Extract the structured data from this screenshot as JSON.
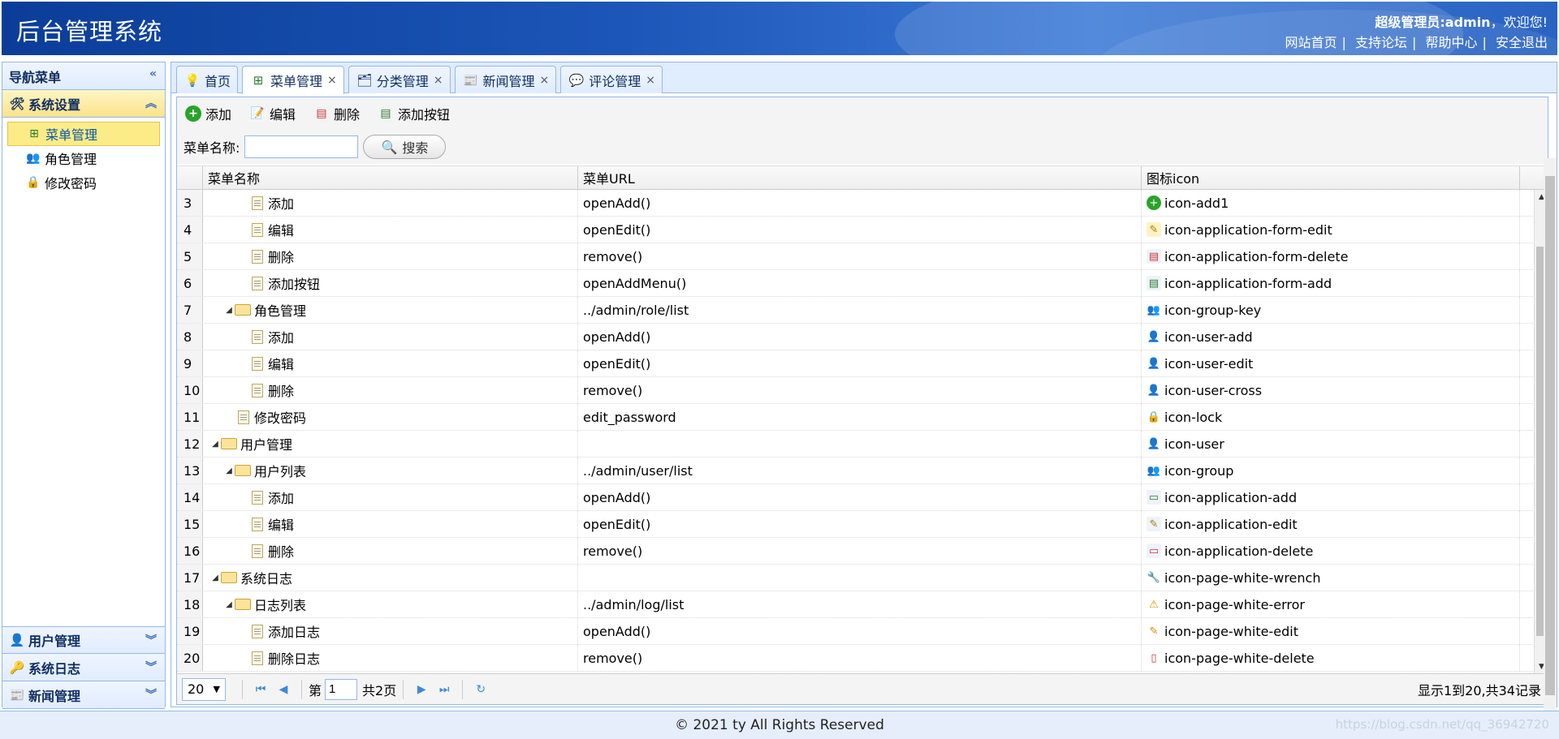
{
  "header": {
    "title": "后台管理系统",
    "welcome_role": "超级管理员:admin",
    "welcome_suffix": "，欢迎您!",
    "links": [
      "网站首页",
      "支持论坛",
      "帮助中心",
      "安全退出"
    ],
    "link_sep": "|"
  },
  "sidebar": {
    "title": "导航菜单",
    "collapse_icon": "«",
    "groups": [
      {
        "label": "系统设置",
        "icon": "wrench-icon"
      },
      {
        "label": "用户管理",
        "icon": "user-icon"
      },
      {
        "label": "系统日志",
        "icon": "key-icon"
      },
      {
        "label": "新闻管理",
        "icon": "news-icon"
      }
    ],
    "items": [
      {
        "label": "菜单管理",
        "icon": "sitemap-icon"
      },
      {
        "label": "角色管理",
        "icon": "group-key-icon"
      },
      {
        "label": "修改密码",
        "icon": "lock-icon"
      }
    ]
  },
  "tabs": [
    {
      "label": "首页",
      "icon": "lightbulb-icon",
      "closable": false
    },
    {
      "label": "菜单管理",
      "icon": "sitemap-icon",
      "closable": true
    },
    {
      "label": "分类管理",
      "icon": "category-icon",
      "closable": true
    },
    {
      "label": "新闻管理",
      "icon": "news-icon",
      "closable": true
    },
    {
      "label": "评论管理",
      "icon": "comment-icon",
      "closable": true
    }
  ],
  "toolbar": {
    "add": "添加",
    "edit": "编辑",
    "delete": "删除",
    "add_button": "添加按钮"
  },
  "search": {
    "label": "菜单名称:",
    "value": "",
    "button": "搜索"
  },
  "grid": {
    "columns": [
      "菜单名称",
      "菜单URL",
      "图标icon"
    ],
    "rows": [
      {
        "num": "3",
        "name": "添加",
        "level": 3,
        "type": "page",
        "url": "openAdd()",
        "icon": "icon-add1"
      },
      {
        "num": "4",
        "name": "编辑",
        "level": 3,
        "type": "page",
        "url": "openEdit()",
        "icon": "icon-application-form-edit"
      },
      {
        "num": "5",
        "name": "删除",
        "level": 3,
        "type": "page",
        "url": "remove()",
        "icon": "icon-application-form-delete"
      },
      {
        "num": "6",
        "name": "添加按钮",
        "level": 3,
        "type": "page",
        "url": "openAddMenu()",
        "icon": "icon-application-form-add"
      },
      {
        "num": "7",
        "name": "角色管理",
        "level": 2,
        "type": "folder",
        "url": "../admin/role/list",
        "icon": "icon-group-key"
      },
      {
        "num": "8",
        "name": "添加",
        "level": 3,
        "type": "page",
        "url": "openAdd()",
        "icon": "icon-user-add"
      },
      {
        "num": "9",
        "name": "编辑",
        "level": 3,
        "type": "page",
        "url": "openEdit()",
        "icon": "icon-user-edit"
      },
      {
        "num": "10",
        "name": "删除",
        "level": 3,
        "type": "page",
        "url": "remove()",
        "icon": "icon-user-cross"
      },
      {
        "num": "11",
        "name": "修改密码",
        "level": 2,
        "type": "page",
        "url": "edit_password",
        "icon": "icon-lock"
      },
      {
        "num": "12",
        "name": "用户管理",
        "level": 1,
        "type": "folder",
        "url": "",
        "icon": "icon-user"
      },
      {
        "num": "13",
        "name": "用户列表",
        "level": 2,
        "type": "folder",
        "url": "../admin/user/list",
        "icon": "icon-group"
      },
      {
        "num": "14",
        "name": "添加",
        "level": 3,
        "type": "page",
        "url": "openAdd()",
        "icon": "icon-application-add"
      },
      {
        "num": "15",
        "name": "编辑",
        "level": 3,
        "type": "page",
        "url": "openEdit()",
        "icon": "icon-application-edit"
      },
      {
        "num": "16",
        "name": "删除",
        "level": 3,
        "type": "page",
        "url": "remove()",
        "icon": "icon-application-delete"
      },
      {
        "num": "17",
        "name": "系统日志",
        "level": 1,
        "type": "folder",
        "url": "",
        "icon": "icon-page-white-wrench"
      },
      {
        "num": "18",
        "name": "日志列表",
        "level": 2,
        "type": "folder",
        "url": "../admin/log/list",
        "icon": "icon-page-white-error"
      },
      {
        "num": "19",
        "name": "添加日志",
        "level": 3,
        "type": "page",
        "url": "openAdd()",
        "icon": "icon-page-white-edit"
      },
      {
        "num": "20",
        "name": "删除日志",
        "level": 3,
        "type": "page",
        "url": "remove()",
        "icon": "icon-page-white-delete"
      }
    ]
  },
  "pager": {
    "page_size": "20",
    "page_prefix": "第",
    "current_page": "1",
    "total_pages": "共2页",
    "record_info": "显示1到20,共34记录"
  },
  "footer": {
    "copyright": "© 2021 ty All Rights Reserved"
  },
  "watermark": "https://blog.csdn.net/qq_36942720",
  "colors": {
    "header_blue": "#1c56b8",
    "border": "#95b8e7",
    "selected": "#fbec88",
    "icon_green": "#29a329"
  }
}
